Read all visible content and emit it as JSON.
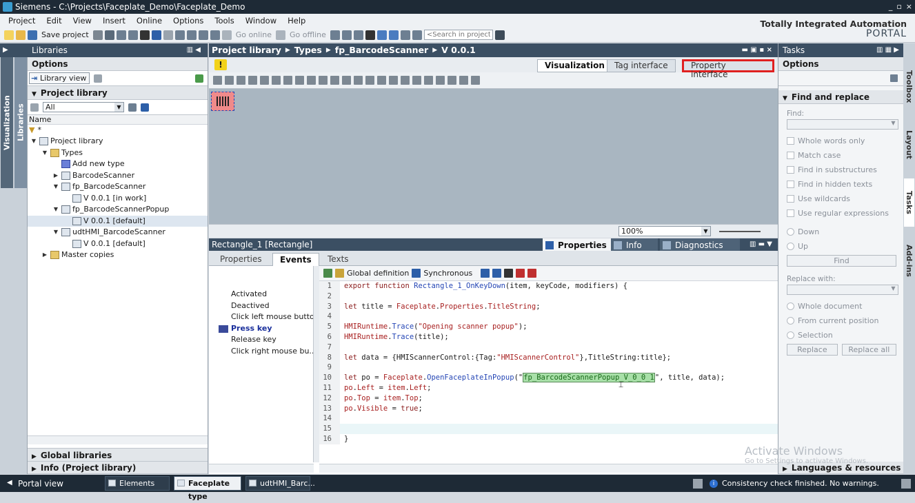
{
  "window": {
    "title": "Siemens - C:\\Projects\\Faceplate_Demo\\Faceplate_Demo",
    "controls": [
      "_",
      "▫",
      "×"
    ]
  },
  "menu": [
    "Project",
    "Edit",
    "View",
    "Insert",
    "Online",
    "Options",
    "Tools",
    "Window",
    "Help"
  ],
  "toolbar": {
    "save_label": "Save project",
    "go_online": "Go online",
    "go_offline": "Go offline",
    "search_placeholder": "<Search in project>"
  },
  "branding": {
    "line1": "Totally Integrated Automation",
    "line2": "PORTAL"
  },
  "left_strip": {
    "tab1": "Visualization",
    "tab2": "Libraries"
  },
  "libraries": {
    "header": "Libraries",
    "options": "Options",
    "library_view": "Library view",
    "project_library": "Project library",
    "filter": "All",
    "col_name": "Name",
    "filter_row": "*",
    "tree": [
      {
        "label": "Project library",
        "level": 0,
        "exp": "▼",
        "icon": "lib"
      },
      {
        "label": "Types",
        "level": 1,
        "exp": "▼",
        "icon": "folder"
      },
      {
        "label": "Add new type",
        "level": 2,
        "exp": "",
        "icon": "star"
      },
      {
        "label": "BarcodeScanner",
        "level": 2,
        "exp": "▶",
        "icon": "type"
      },
      {
        "label": "fp_BarcodeScanner",
        "level": 2,
        "exp": "▼",
        "icon": "type"
      },
      {
        "label": "V 0.0.1 [in work]",
        "level": 3,
        "exp": "",
        "icon": "ver"
      },
      {
        "label": "fp_BarcodeScannerPopup",
        "level": 2,
        "exp": "▼",
        "icon": "type"
      },
      {
        "label": "V 0.0.1 [default]",
        "level": 3,
        "exp": "",
        "icon": "ver",
        "selected": true
      },
      {
        "label": "udtHMI_BarcodeScanner",
        "level": 2,
        "exp": "▼",
        "icon": "type"
      },
      {
        "label": "V 0.0.1 [default]",
        "level": 3,
        "exp": "",
        "icon": "ver"
      },
      {
        "label": "Master copies",
        "level": 1,
        "exp": "▶",
        "icon": "folder"
      }
    ],
    "global_libraries": "Global libraries",
    "info": "Info (Project library)"
  },
  "editor": {
    "breadcrumb": [
      "Project library",
      "Types",
      "fp_BarcodeScanner",
      "V 0.0.1"
    ],
    "tabs": [
      "Visualization",
      "Tag interface",
      "Property interface"
    ],
    "zoom": "100%"
  },
  "inspector": {
    "object": "Rectangle_1 [Rectangle]",
    "tabs": [
      "Properties",
      "Info",
      "Diagnostics"
    ],
    "sub_tabs": [
      "Properties",
      "Events",
      "Texts"
    ],
    "events": [
      "Activated",
      "Deactived",
      "Click left mouse button",
      "Press key",
      "Release key",
      "Click right mouse bu..."
    ],
    "global_definition": "Global definition",
    "synchronous": "Synchronous"
  },
  "code_lines": [
    {
      "n": "1",
      "parts": [
        [
          "kw",
          "export function "
        ],
        [
          "fn",
          "Rectangle_1_OnKeyDown"
        ],
        [
          "",
          "(item, keyCode, modifiers) {"
        ]
      ]
    },
    {
      "n": "2",
      "parts": []
    },
    {
      "n": "3",
      "parts": [
        [
          "kw",
          "let "
        ],
        [
          "",
          "title = "
        ],
        [
          "str",
          "Faceplate"
        ],
        [
          "",
          "."
        ],
        [
          "str",
          "Properties"
        ],
        [
          "",
          "."
        ],
        [
          "str",
          "TitleString"
        ],
        [
          "",
          ";"
        ]
      ]
    },
    {
      "n": "4",
      "parts": []
    },
    {
      "n": "5",
      "parts": [
        [
          "str",
          "HMIRuntime"
        ],
        [
          "",
          "."
        ],
        [
          "fn",
          "Trace"
        ],
        [
          "",
          "("
        ],
        [
          "str",
          "\"Opening scanner popup\""
        ],
        [
          "",
          ");"
        ]
      ]
    },
    {
      "n": "6",
      "parts": [
        [
          "str",
          "HMIRuntime"
        ],
        [
          "",
          "."
        ],
        [
          "fn",
          "Trace"
        ],
        [
          "",
          "(title);"
        ]
      ]
    },
    {
      "n": "7",
      "parts": []
    },
    {
      "n": "8",
      "parts": [
        [
          "kw",
          "let "
        ],
        [
          "",
          "data = {HMIScannerControl:{Tag:"
        ],
        [
          "str",
          "\"HMIScannerControl\""
        ],
        [
          "",
          "},TitleString:title};"
        ]
      ]
    },
    {
      "n": "9",
      "parts": []
    },
    {
      "n": "10",
      "parts": [
        [
          "kw",
          "let "
        ],
        [
          "",
          "po = "
        ],
        [
          "str",
          "Faceplate"
        ],
        [
          "",
          "."
        ],
        [
          "fn",
          "OpenFaceplateInPopup"
        ],
        [
          "",
          "(\""
        ],
        [
          "hl",
          "fp_BarcodeScannerPopup_V_0_0_1"
        ],
        [
          "",
          "\", title, data);"
        ]
      ]
    },
    {
      "n": "11",
      "parts": [
        [
          "str",
          "po"
        ],
        [
          "",
          "."
        ],
        [
          "str",
          "Left"
        ],
        [
          "",
          " = "
        ],
        [
          "str",
          "item"
        ],
        [
          "",
          "."
        ],
        [
          "str",
          "Left"
        ],
        [
          "",
          ";"
        ]
      ]
    },
    {
      "n": "12",
      "parts": [
        [
          "str",
          "po"
        ],
        [
          "",
          "."
        ],
        [
          "str",
          "Top"
        ],
        [
          "",
          " = "
        ],
        [
          "str",
          "item"
        ],
        [
          "",
          "."
        ],
        [
          "str",
          "Top"
        ],
        [
          "",
          ";"
        ]
      ]
    },
    {
      "n": "13",
      "parts": [
        [
          "str",
          "po"
        ],
        [
          "",
          "."
        ],
        [
          "str",
          "Visible"
        ],
        [
          "",
          " = "
        ],
        [
          "kw",
          "true"
        ],
        [
          "",
          ";"
        ]
      ]
    },
    {
      "n": "14",
      "parts": []
    },
    {
      "n": "15",
      "parts": []
    },
    {
      "n": "16",
      "parts": [
        [
          "",
          "}"
        ]
      ]
    }
  ],
  "tasks": {
    "header": "Tasks",
    "options": "Options",
    "find_replace": "Find and replace",
    "find_label": "Find:",
    "checks": [
      "Whole words only",
      "Match case",
      "Find in substructures",
      "Find in hidden texts",
      "Use wildcards",
      "Use regular expressions"
    ],
    "dir": [
      "Down",
      "Up"
    ],
    "find_btn": "Find",
    "replace_label": "Replace with:",
    "scope": [
      "Whole document",
      "From current position",
      "Selection"
    ],
    "replace_btn": "Replace",
    "replace_all_btn": "Replace all",
    "languages": "Languages & resources"
  },
  "right_strip": [
    "Toolbox",
    "Layout",
    "Tasks",
    "Add-ins"
  ],
  "status": {
    "portal_view": "Portal view",
    "tabs": [
      "Elements",
      "Faceplate type",
      "udtHMI_Barc..."
    ],
    "message": "Consistency check finished. No warnings."
  },
  "watermark": {
    "line1": "Activate Windows",
    "line2": "Go to Settings to activate Windows."
  },
  "colors": {
    "accent_red": "#e02020",
    "header_blue": "#3b4f63",
    "code_keyword": "#8a1b1b",
    "code_function": "#2546b5"
  }
}
